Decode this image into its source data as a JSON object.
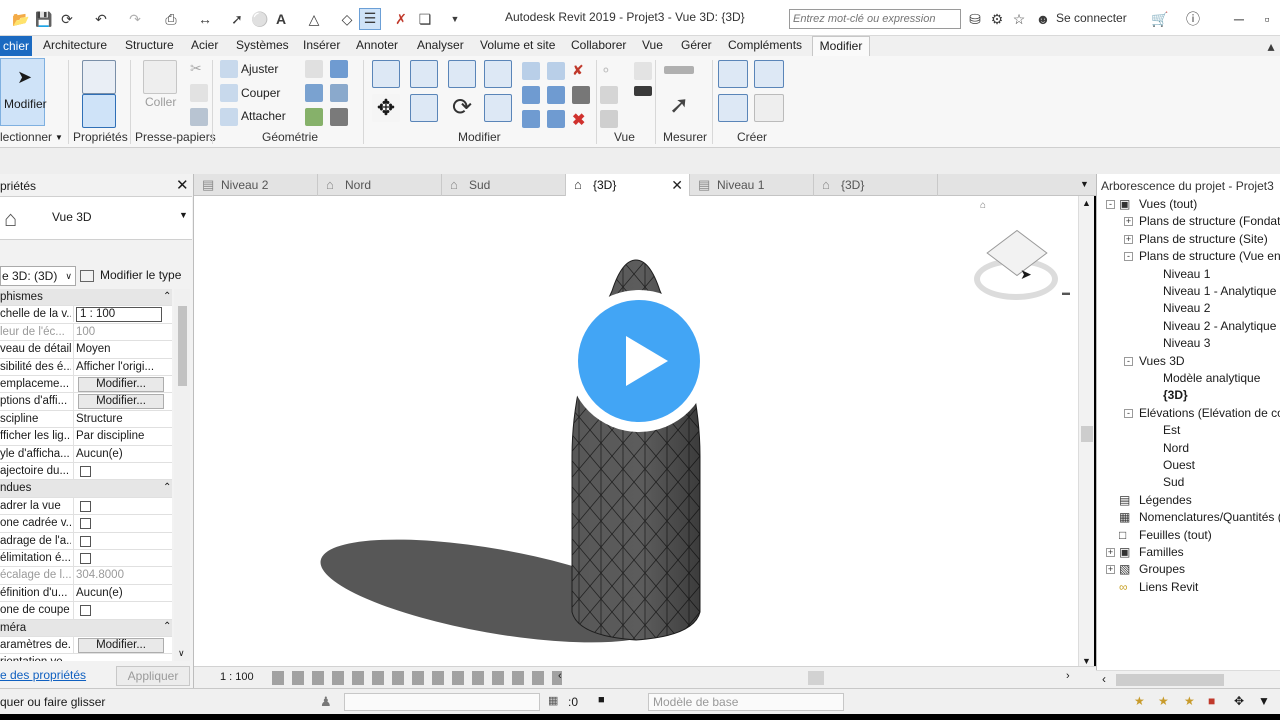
{
  "window": {
    "title": "Autodesk Revit 2019 - Projet3 - Vue 3D: {3D}",
    "search_placeholder": "Entrez mot-clé ou expression",
    "login": "Se connecter"
  },
  "ribbon_tabs": {
    "file": "chier",
    "items": [
      "Architecture",
      "Structure",
      "Acier",
      "Systèmes",
      "Insérer",
      "Annoter",
      "Analyser",
      "Volume et site",
      "Collaborer",
      "Vue",
      "Gérer",
      "Compléments",
      "Modifier"
    ]
  },
  "ribbon": {
    "modify_big": "Modifier",
    "select_group": "lectionner",
    "properties": "Propriétés",
    "clipboard": "Presse-papiers",
    "paste": "Coller",
    "geometry": "Géométrie",
    "modify_group": "Modifier",
    "view_group": "Vue",
    "measure_group": "Mesurer",
    "create_group": "Créer",
    "ajuster": "Ajuster",
    "couper": "Couper",
    "attacher": "Attacher"
  },
  "properties": {
    "title": "priétés",
    "type_name": "Vue 3D",
    "view_select": "e 3D: (3D)",
    "edit_type": "Modifier le type",
    "rows": [
      {
        "label": "phismes",
        "value": "",
        "kind": "cat"
      },
      {
        "label": "chelle de la v...",
        "value": "1 : 100",
        "kind": "edit"
      },
      {
        "label": "leur de l'éc...",
        "value": "100",
        "kind": "dis"
      },
      {
        "label": "veau de détail",
        "value": "Moyen",
        "kind": "text"
      },
      {
        "label": "sibilité des é...",
        "value": "Afficher l'origi...",
        "kind": "text"
      },
      {
        "label": "emplaceme...",
        "value": "Modifier...",
        "kind": "btn"
      },
      {
        "label": "ptions d'affi...",
        "value": "Modifier...",
        "kind": "btn"
      },
      {
        "label": "scipline",
        "value": "Structure",
        "kind": "text"
      },
      {
        "label": "fficher les lig...",
        "value": "Par discipline",
        "kind": "text"
      },
      {
        "label": "yle d'afficha...",
        "value": "Aucun(e)",
        "kind": "text"
      },
      {
        "label": "ajectoire du...",
        "value": "",
        "kind": "chk"
      },
      {
        "label": "ndues",
        "value": "",
        "kind": "cat"
      },
      {
        "label": "adrer la vue",
        "value": "",
        "kind": "chk"
      },
      {
        "label": "one cadrée v...",
        "value": "",
        "kind": "chk"
      },
      {
        "label": "adrage de l'a...",
        "value": "",
        "kind": "chk"
      },
      {
        "label": "élimitation é...",
        "value": "",
        "kind": "chk"
      },
      {
        "label": "écalage de l...",
        "value": "304.8000",
        "kind": "dis"
      },
      {
        "label": "éfinition d'u...",
        "value": "Aucun(e)",
        "kind": "text"
      },
      {
        "label": "one de coupe",
        "value": "",
        "kind": "chk"
      },
      {
        "label": "méra",
        "value": "",
        "kind": "cat"
      },
      {
        "label": "aramètres de...",
        "value": "Modifier...",
        "kind": "btn"
      },
      {
        "label": "rientation ve...",
        "value": "",
        "kind": "text"
      }
    ],
    "help_link": "e des propriétés",
    "apply": "Appliquer"
  },
  "view_tabs": [
    {
      "label": "Niveau 2",
      "icon": "plan-icon",
      "active": false
    },
    {
      "label": "Nord",
      "icon": "elevation-icon",
      "active": false
    },
    {
      "label": "Sud",
      "icon": "elevation-icon",
      "active": false
    },
    {
      "label": "{3D}",
      "icon": "3d-view-icon",
      "active": true
    },
    {
      "label": "Niveau 1",
      "icon": "plan-icon",
      "active": false
    },
    {
      "label": "{3D}",
      "icon": "3d-view-icon",
      "active": false
    }
  ],
  "viewport": {
    "scale": "1 : 100"
  },
  "browser": {
    "title": "Arborescence du projet - Projet3",
    "tree": [
      {
        "label": "Vues (tout)",
        "level": 0,
        "toggle": "-"
      },
      {
        "label": "Plans de structure (Fondation)",
        "level": 1,
        "toggle": "+"
      },
      {
        "label": "Plans de structure (Site)",
        "level": 1,
        "toggle": "+"
      },
      {
        "label": "Plans de structure (Vue en plan)",
        "level": 1,
        "toggle": "-"
      },
      {
        "label": "Niveau 1",
        "level": 2,
        "toggle": ""
      },
      {
        "label": "Niveau 1 - Analytique",
        "level": 2,
        "toggle": ""
      },
      {
        "label": "Niveau 2",
        "level": 2,
        "toggle": ""
      },
      {
        "label": "Niveau 2 - Analytique",
        "level": 2,
        "toggle": ""
      },
      {
        "label": "Niveau 3",
        "level": 2,
        "toggle": ""
      },
      {
        "label": "Vues 3D",
        "level": 1,
        "toggle": "-"
      },
      {
        "label": "Modèle analytique",
        "level": 2,
        "toggle": ""
      },
      {
        "label": "{3D}",
        "level": 2,
        "toggle": "",
        "bold": true
      },
      {
        "label": "Elévations (Elévation de construction)",
        "level": 1,
        "toggle": "-"
      },
      {
        "label": "Est",
        "level": 2,
        "toggle": ""
      },
      {
        "label": "Nord",
        "level": 2,
        "toggle": ""
      },
      {
        "label": "Ouest",
        "level": 2,
        "toggle": ""
      },
      {
        "label": "Sud",
        "level": 2,
        "toggle": ""
      },
      {
        "label": "Légendes",
        "level": 0,
        "toggle": "",
        "icon": "legend-icon"
      },
      {
        "label": "Nomenclatures/Quantités (tout)",
        "level": 0,
        "toggle": "",
        "icon": "schedule-icon"
      },
      {
        "label": "Feuilles (tout)",
        "level": 0,
        "toggle": "",
        "icon": "sheet-icon"
      },
      {
        "label": "Familles",
        "level": 0,
        "toggle": "+",
        "icon": "family-icon"
      },
      {
        "label": "Groupes",
        "level": 0,
        "toggle": "+",
        "icon": "group-icon"
      },
      {
        "label": "Liens Revit",
        "level": 0,
        "toggle": "",
        "icon": "link-icon"
      }
    ]
  },
  "status": {
    "text": "quer ou faire glisser",
    "count": ":0",
    "model": "Modèle de base"
  },
  "colors": {
    "accent": "#1b6ac1",
    "play": "#42a5f5"
  }
}
